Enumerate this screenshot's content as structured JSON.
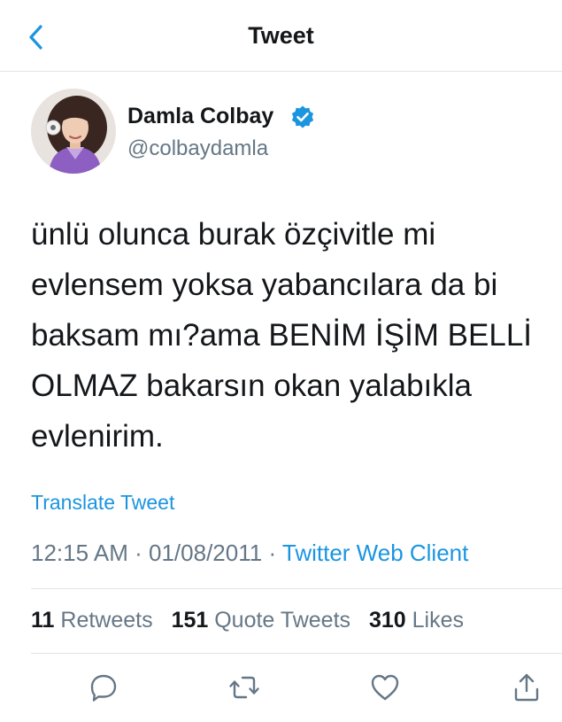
{
  "header": {
    "title": "Tweet",
    "back_icon": "chevron-left-icon"
  },
  "author": {
    "display_name": "Damla Colbay",
    "handle": "@colbaydamla",
    "verified_icon": "verified-badge-icon"
  },
  "tweet": {
    "text": "ünlü olunca burak özçivitle mi\nevlensem yoksa yabancılara da bi\nbaksam mı?ama BENİM İŞİM BELLİ\nOLMAZ bakarsın okan yalabıkla\nevlenirim.",
    "translate_label": "Translate Tweet"
  },
  "meta": {
    "time": "12:15 AM",
    "separator": "·",
    "date": "01/08/2011",
    "source": "Twitter Web Client"
  },
  "stats": {
    "retweets_count": "11",
    "retweets_label": "Retweets",
    "quotes_count": "151",
    "quotes_label": "Quote Tweets",
    "likes_count": "310",
    "likes_label": "Likes"
  },
  "actions": [
    "reply-icon",
    "retweet-icon",
    "like-icon",
    "share-icon"
  ],
  "colors": {
    "accent": "#1b95e0",
    "text": "#14171a",
    "secondary": "#657786",
    "divider": "#e1e4e8"
  }
}
